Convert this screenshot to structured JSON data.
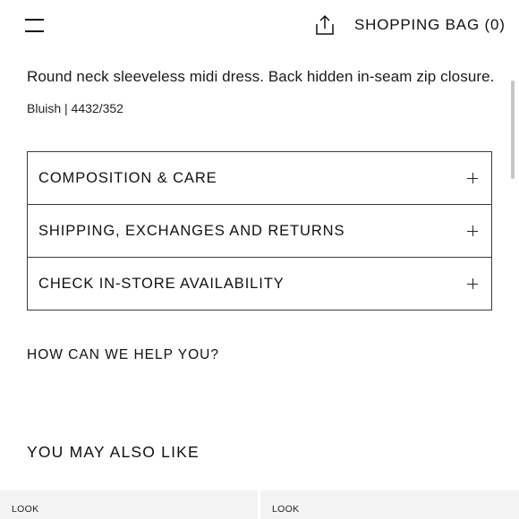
{
  "header": {
    "menu_icon": "hamburger-menu-icon",
    "share_icon": "share-upload-icon",
    "bag_label": "SHOPPING BAG (0)"
  },
  "product": {
    "description": "Round neck sleeveless midi dress. Back hidden in-seam zip closure.",
    "color_ref": "Bluish | 4432/352"
  },
  "accordion": [
    {
      "label": "COMPOSITION & CARE"
    },
    {
      "label": "SHIPPING, EXCHANGES AND RETURNS"
    },
    {
      "label": "CHECK IN-STORE AVAILABILITY"
    }
  ],
  "help": {
    "label": "HOW CAN WE HELP YOU?"
  },
  "recommendations": {
    "title": "YOU MAY ALSO LIKE",
    "cards": [
      {
        "label": "LOOK"
      },
      {
        "label": "LOOK"
      }
    ]
  }
}
